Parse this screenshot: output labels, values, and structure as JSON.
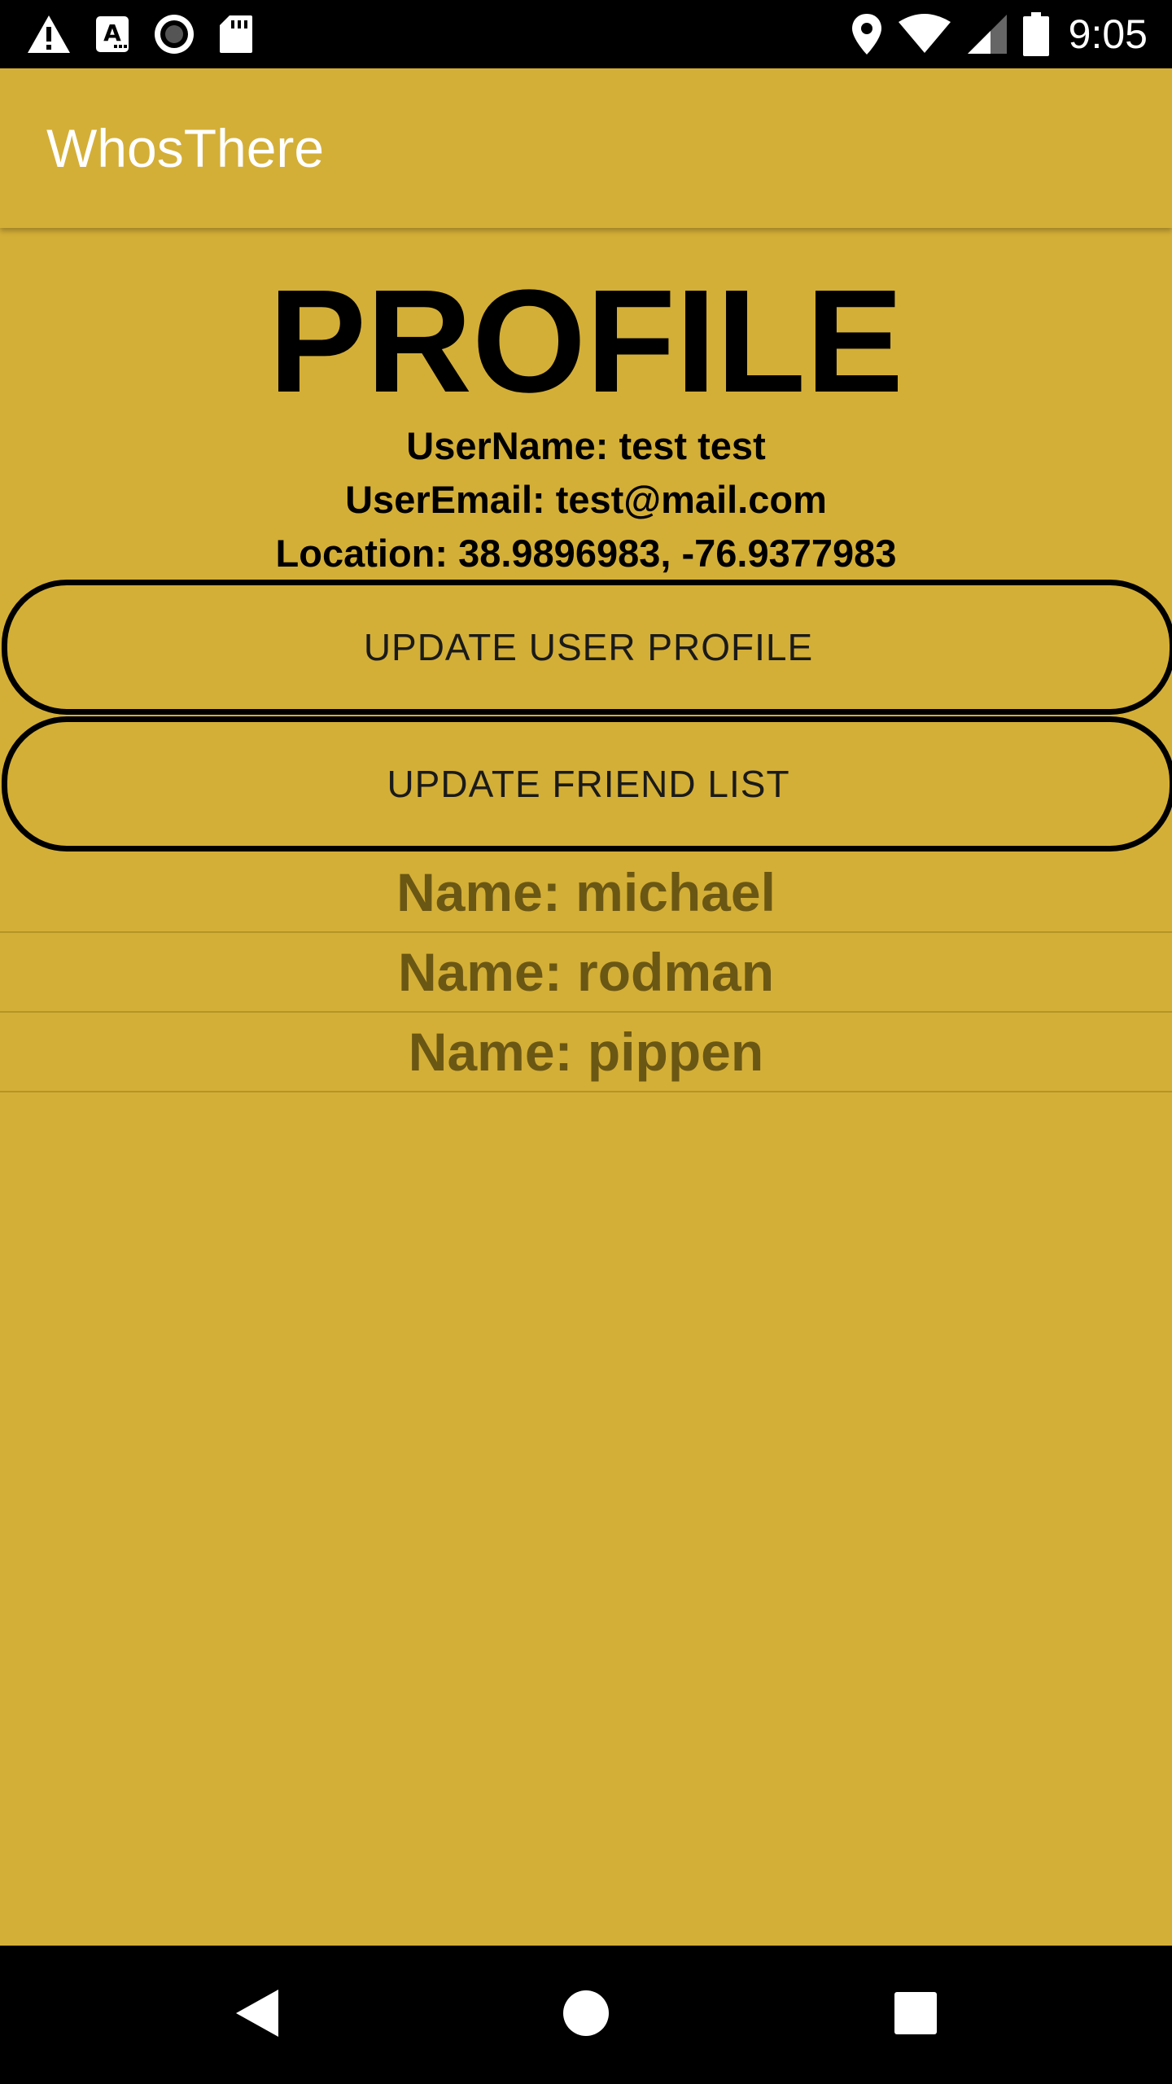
{
  "status_bar": {
    "time": "9:05",
    "left_icons": [
      "warning-icon",
      "keyboard-a-icon",
      "record-icon",
      "sd-card-icon"
    ],
    "right_icons": [
      "location-pin-icon",
      "wifi-icon",
      "cell-signal-icon",
      "battery-icon"
    ]
  },
  "app_bar": {
    "title": "WhosThere"
  },
  "profile": {
    "heading": "PROFILE",
    "username_line": "UserName: test test",
    "email_line": "UserEmail: test@mail.com",
    "location_line": "Location: 38.9896983, -76.9377983"
  },
  "buttons": {
    "update_profile": "UPDATE USER PROFILE",
    "update_friends": "UPDATE FRIEND LIST"
  },
  "friends": [
    {
      "label": "Name: michael"
    },
    {
      "label": "Name: rodman"
    },
    {
      "label": "Name: pippen"
    }
  ],
  "nav_bar": {
    "buttons": [
      "back-icon",
      "home-icon",
      "recents-icon"
    ]
  },
  "colors": {
    "background": "#d4af37",
    "status_bar": "#000000",
    "friend_text": "#6b5714"
  }
}
